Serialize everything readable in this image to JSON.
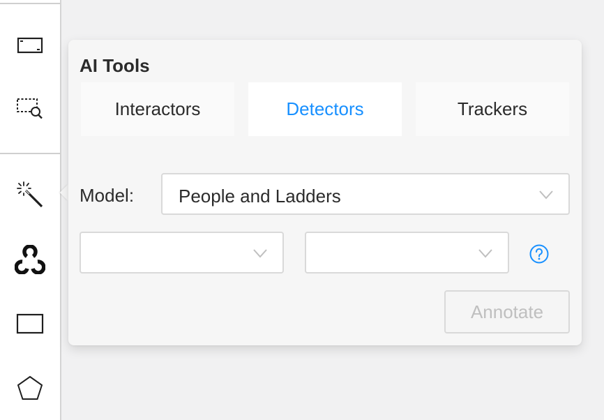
{
  "toolbar": {
    "tools": [
      {
        "icon": "fit-frame-icon"
      },
      {
        "icon": "zoom-region-icon"
      },
      {
        "icon": "magic-wand-icon"
      },
      {
        "icon": "opencv-icon"
      },
      {
        "icon": "rectangle-icon"
      },
      {
        "icon": "polygon-icon"
      }
    ]
  },
  "ai_tools": {
    "title": "AI Tools",
    "tabs": [
      {
        "label": "Interactors",
        "active": false
      },
      {
        "label": "Detectors",
        "active": true
      },
      {
        "label": "Trackers",
        "active": false
      }
    ],
    "model_label": "Model:",
    "model_value": "People and Ladders",
    "mapping_left_value": "",
    "mapping_right_value": "",
    "help_icon": "question-circle-icon",
    "annotate_label": "Annotate",
    "annotate_disabled": true
  },
  "colors": {
    "accent": "#1890ff",
    "disabled_text": "#bfbfbf",
    "border": "#d9d9d9"
  }
}
